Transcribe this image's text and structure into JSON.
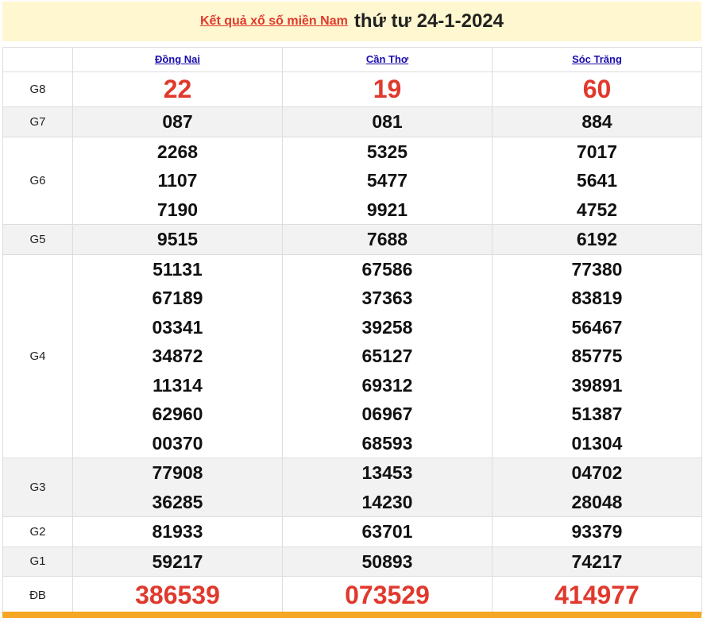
{
  "header": {
    "link_text": "Kết quả xổ số miền Nam",
    "date_text": "thứ tư 24-1-2024"
  },
  "provinces": [
    "Đồng Nai",
    "Cần Thơ",
    "Sóc Trăng"
  ],
  "prizes": [
    {
      "label": "G8",
      "values": [
        [
          "22"
        ],
        [
          "19"
        ],
        [
          "60"
        ]
      ]
    },
    {
      "label": "G7",
      "values": [
        [
          "087"
        ],
        [
          "081"
        ],
        [
          "884"
        ]
      ]
    },
    {
      "label": "G6",
      "values": [
        [
          "2268",
          "1107",
          "7190"
        ],
        [
          "5325",
          "5477",
          "9921"
        ],
        [
          "7017",
          "5641",
          "4752"
        ]
      ]
    },
    {
      "label": "G5",
      "values": [
        [
          "9515"
        ],
        [
          "7688"
        ],
        [
          "6192"
        ]
      ]
    },
    {
      "label": "G4",
      "values": [
        [
          "51131",
          "67189",
          "03341",
          "34872",
          "11314",
          "62960",
          "00370"
        ],
        [
          "67586",
          "37363",
          "39258",
          "65127",
          "69312",
          "06967",
          "68593"
        ],
        [
          "77380",
          "83819",
          "56467",
          "85775",
          "39891",
          "51387",
          "01304"
        ]
      ]
    },
    {
      "label": "G3",
      "values": [
        [
          "77908",
          "36285"
        ],
        [
          "13453",
          "14230"
        ],
        [
          "04702",
          "28048"
        ]
      ]
    },
    {
      "label": "G2",
      "values": [
        [
          "81933"
        ],
        [
          "63701"
        ],
        [
          "93379"
        ]
      ]
    },
    {
      "label": "G1",
      "values": [
        [
          "59217"
        ],
        [
          "50893"
        ],
        [
          "74217"
        ]
      ]
    },
    {
      "label": "ĐB",
      "values": [
        [
          "386539"
        ],
        [
          "073529"
        ],
        [
          "414977"
        ]
      ]
    }
  ],
  "colors": {
    "header_bg": "#fff7cf",
    "accent_red": "#e0392d",
    "link_blue": "#1a0dab",
    "row_gray": "#f2f2f2",
    "bottom_bar": "#f5a623"
  }
}
